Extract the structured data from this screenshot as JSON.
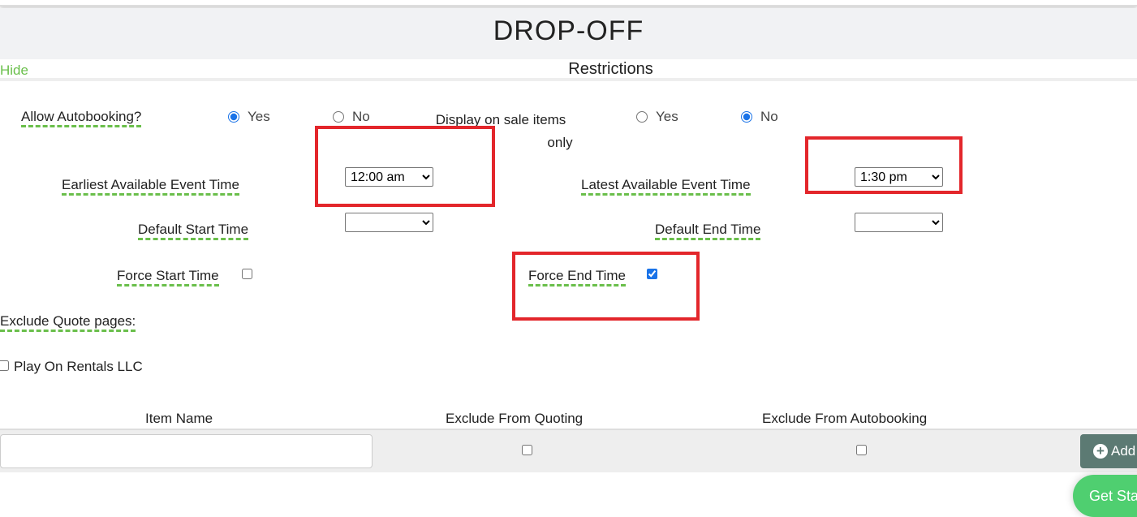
{
  "header": {
    "title": "DROP-OFF"
  },
  "section": {
    "hide_label": "Hide",
    "title": "Restrictions"
  },
  "form": {
    "allow_autobooking": {
      "label": "Allow Autobooking?",
      "yes": "Yes",
      "no": "No",
      "selected": "Yes"
    },
    "display_on_sale": {
      "label_line1": "Display on sale items",
      "label_line2": "only",
      "yes": "Yes",
      "no": "No",
      "selected": "No"
    },
    "earliest": {
      "label": "Earliest Available Event Time",
      "value": "12:00 am"
    },
    "latest": {
      "label": "Latest Available Event Time",
      "value": "1:30 pm"
    },
    "default_start": {
      "label": "Default Start Time",
      "value": ""
    },
    "default_end": {
      "label": "Default End Time",
      "value": ""
    },
    "force_start": {
      "label": "Force Start Time",
      "checked": false
    },
    "force_end": {
      "label": "Force End Time",
      "checked": true
    },
    "exclude_quote": {
      "label": "Exclude Quote pages:"
    },
    "play_on": {
      "label": "Play On Rentals LLC",
      "checked": false
    }
  },
  "table": {
    "headers": [
      "Item Name",
      "Exclude From Quoting",
      "Exclude From Autobooking"
    ],
    "item_name_value": "",
    "add_label": "Add"
  },
  "get_started": {
    "label": "Get Sta"
  },
  "colors": {
    "accent_green": "#6abf4b",
    "highlight_red": "#e3262b",
    "add_button": "#5c7a73",
    "get_started": "#4fcf70"
  }
}
